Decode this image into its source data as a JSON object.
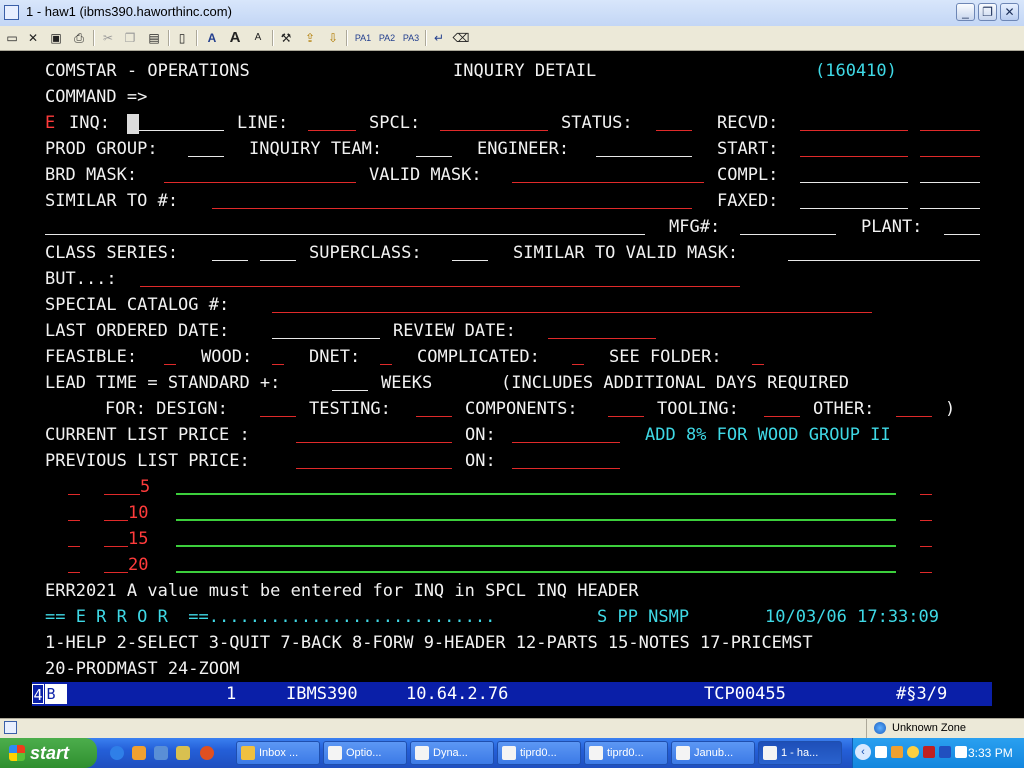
{
  "window": {
    "title": "1 - haw1 (ibms390.haworthinc.com)",
    "buttons": {
      "minimize": "_",
      "maximize": "❐",
      "close": "✕"
    }
  },
  "toolbar": {
    "icons": [
      "print-screen-icon",
      "disconnect-icon",
      "save-icon",
      "printer-icon",
      "cut-icon",
      "copy-icon",
      "paste-icon",
      "clipboard-icon",
      "font-icon",
      "font-larger-icon",
      "font-smaller-icon",
      "tools-icon",
      "send-file-icon",
      "receive-file-icon",
      "enter-icon",
      "erase-icon"
    ],
    "pa1": "PA1",
    "pa2": "PA2",
    "pa3": "PA3"
  },
  "screen": {
    "header": {
      "app": "COMSTAR - OPERATIONS",
      "title": "INQUIRY DETAIL",
      "code": "(160410)"
    },
    "command": "COMMAND =>",
    "error_flag": "E",
    "labels": {
      "inq": "INQ:",
      "line": "LINE:",
      "spcl": "SPCL:",
      "status": "STATUS:",
      "recvd": "RECVD:",
      "prod_group": "PROD GROUP:",
      "inquiry_team": "INQUIRY TEAM:",
      "engineer": "ENGINEER:",
      "start": "START:",
      "brd_mask": "BRD MASK:",
      "valid_mask": "VALID MASK:",
      "compl": "COMPL:",
      "similar_to": "SIMILAR TO #:",
      "faxed": "FAXED:",
      "mfg": "MFG#:",
      "plant": "PLANT:",
      "class_series": "CLASS SERIES:",
      "superclass": "SUPERCLASS:",
      "similar_valid_mask": "SIMILAR TO VALID MASK:",
      "but": "BUT...:",
      "special_catalog": "SPECIAL CATALOG #:",
      "last_ordered": "LAST ORDERED DATE:",
      "review_date": "REVIEW DATE:",
      "feasible": "FEASIBLE:",
      "wood": "WOOD:",
      "dnet": "DNET:",
      "complicated": "COMPLICATED:",
      "see_folder": "SEE FOLDER:",
      "lead_time": "LEAD TIME = STANDARD +:",
      "weeks": "WEEKS",
      "includes": "(INCLUDES ADDITIONAL DAYS REQUIRED",
      "for_design": "FOR: DESIGN:",
      "testing": "TESTING:",
      "components": "COMPONENTS:",
      "tooling": "TOOLING:",
      "other": "OTHER:",
      "close_paren": ")",
      "current_price": "CURRENT LIST PRICE :",
      "on": "ON:",
      "wood_note": "ADD 8% FOR WOOD GROUP II",
      "previous_price": "PREVIOUS LIST PRICE:"
    },
    "notes": [
      {
        "num": "5"
      },
      {
        "num": "10"
      },
      {
        "num": "15"
      },
      {
        "num": "20"
      }
    ],
    "message": "ERR2021 A value must be entered for INQ in SPCL INQ HEADER",
    "error_line": {
      "banner": "== E R R O R  ==............................",
      "info": "S PP NSMP",
      "datetime": "10/03/06 17:33:09"
    },
    "pf_keys_1": "1-HELP 2-SELECT 3-QUIT 7-BACK 8-FORW 9-HEADER 12-PARTS 15-NOTES 17-PRICEMST",
    "pf_keys_2": "20-PRODMAST 24-ZOOM"
  },
  "status_bar": {
    "cell1": "4",
    "cell2": "B",
    "session": "1",
    "host": "IBMS390",
    "ip": "10.64.2.76",
    "lu": "TCP00455",
    "cursor_pos": "#§3/9"
  },
  "info_bar": {
    "zone": "Unknown Zone"
  },
  "taskbar": {
    "start": "start",
    "tasks": [
      "Inbox ...",
      "Optio...",
      "Dyna...",
      "tiprd0...",
      "tiprd0...",
      "Janub...",
      "1 - ha..."
    ],
    "clock": "3:33 PM"
  }
}
